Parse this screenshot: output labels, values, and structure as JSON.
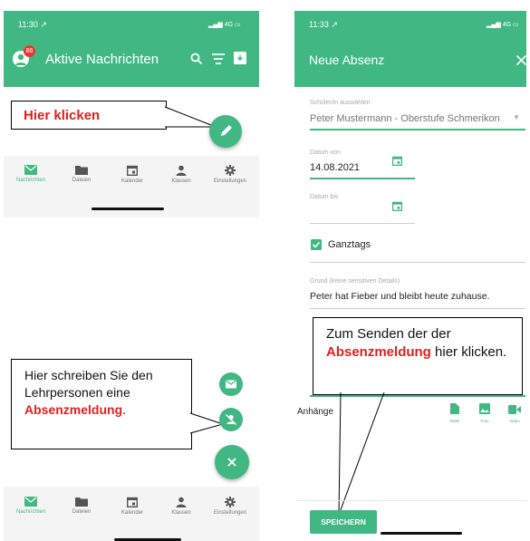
{
  "left_phone": {
    "status": {
      "time": "11:30 ↗",
      "network": "4G"
    },
    "header": {
      "badge_count": "86",
      "title": "Aktive Nachrichten"
    },
    "tabs": [
      {
        "label": "Nachrichten",
        "icon": "mail-icon",
        "active": true
      },
      {
        "label": "Dateien",
        "icon": "folder-icon",
        "active": false
      },
      {
        "label": "Kalender",
        "icon": "calendar-icon",
        "active": false
      },
      {
        "label": "Klassen",
        "icon": "person-icon",
        "active": false
      },
      {
        "label": "Einstellungen",
        "icon": "gear-icon",
        "active": false
      }
    ],
    "callout_top": "Hier klicken",
    "callout_bottom": {
      "text": "Hier schreiben Sie den Lehrpersonen eine",
      "highlight": "Absenzmeldung",
      "suffix": "."
    }
  },
  "right_phone": {
    "status": {
      "time": "11:33 ↗",
      "network": "4G"
    },
    "header": {
      "title": "Neue Absenz"
    },
    "student": {
      "placeholder": "Schüler/in auswählen",
      "value": "Peter Mustermann - Oberstufe Schmerikon"
    },
    "date_from": {
      "label": "Datum von",
      "value": "14.08.2021"
    },
    "date_to": {
      "label": "Datum bis",
      "value": ""
    },
    "fullday": {
      "label": "Ganztags",
      "checked": true
    },
    "reason": {
      "label": "Grund (keine sensitiven Details)",
      "value": "Peter hat Fieber und bleibt heute zuhause."
    },
    "attachments": {
      "label": "Anhänge",
      "items": [
        {
          "label": "Datei",
          "icon": "file-icon"
        },
        {
          "label": "Foto",
          "icon": "image-icon"
        },
        {
          "label": "Video",
          "icon": "video-icon"
        }
      ]
    },
    "save_label": "SPEICHERN",
    "callout": {
      "text": "Zum Senden der der",
      "highlight": "Absenzmeldung",
      "suffix": "hier klicken."
    }
  },
  "colors": {
    "accent": "#41b883",
    "callout_highlight": "#e02020"
  }
}
